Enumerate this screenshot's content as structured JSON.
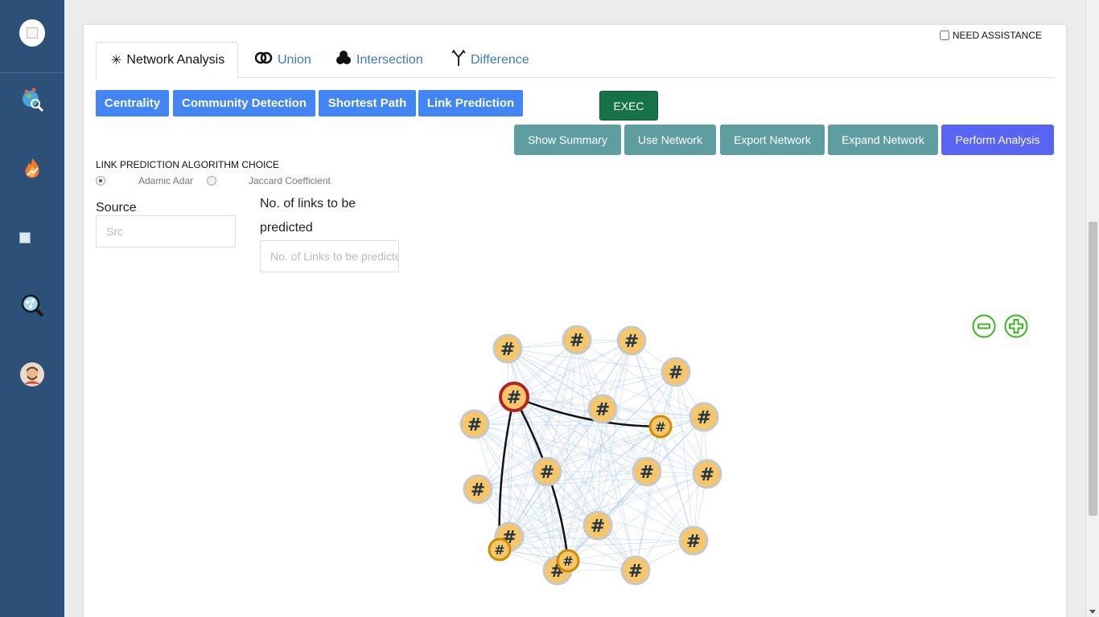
{
  "sidebar": {
    "items": [
      {
        "icon": "logo-icon"
      },
      {
        "icon": "globe-search-icon"
      },
      {
        "icon": "trending-flame-icon"
      },
      {
        "icon": "broken-image-icon"
      },
      {
        "icon": "network-search-icon"
      },
      {
        "icon": "user-avatar-icon"
      }
    ]
  },
  "assistance": {
    "label": "NEED ASSISTANCE"
  },
  "tabs": [
    {
      "label": "Network Analysis",
      "icon": "network-icon",
      "active": true
    },
    {
      "label": "Union",
      "icon": "union-icon"
    },
    {
      "label": "Intersection",
      "icon": "intersection-icon"
    },
    {
      "label": "Difference",
      "icon": "difference-icon"
    }
  ],
  "algorithms": [
    "Centrality",
    "Community Detection",
    "Shortest Path",
    "Link Prediction"
  ],
  "exec_label": "EXEC",
  "actions": [
    "Show Summary",
    "Use Network",
    "Export Network",
    "Expand Network",
    "Perform Analysis"
  ],
  "link_prediction": {
    "title": "LINK PREDICTION ALGORITHM CHOICE",
    "options": [
      "Adamic Adar",
      "Jaccard Coefficient"
    ],
    "selected": "Adamic Adar"
  },
  "form": {
    "source_label": "Source",
    "source_placeholder": "Src",
    "links_label_line1": "No. of links to be",
    "links_label_line2": "predicted",
    "links_placeholder": "No. of Links to be predicted"
  },
  "graph": {
    "node_glyph": "#",
    "colors": {
      "node_fill": "#f5c76a",
      "node_ring": "#c8c8c8",
      "source_ring": "#b22222",
      "predicted_ring": "#d18b00",
      "edge": "#a9c8ef",
      "predicted_edge": "#111111"
    }
  },
  "zoom": {
    "out_icon": "zoom-out-icon",
    "in_icon": "zoom-in-icon",
    "color": "#3cb521"
  }
}
